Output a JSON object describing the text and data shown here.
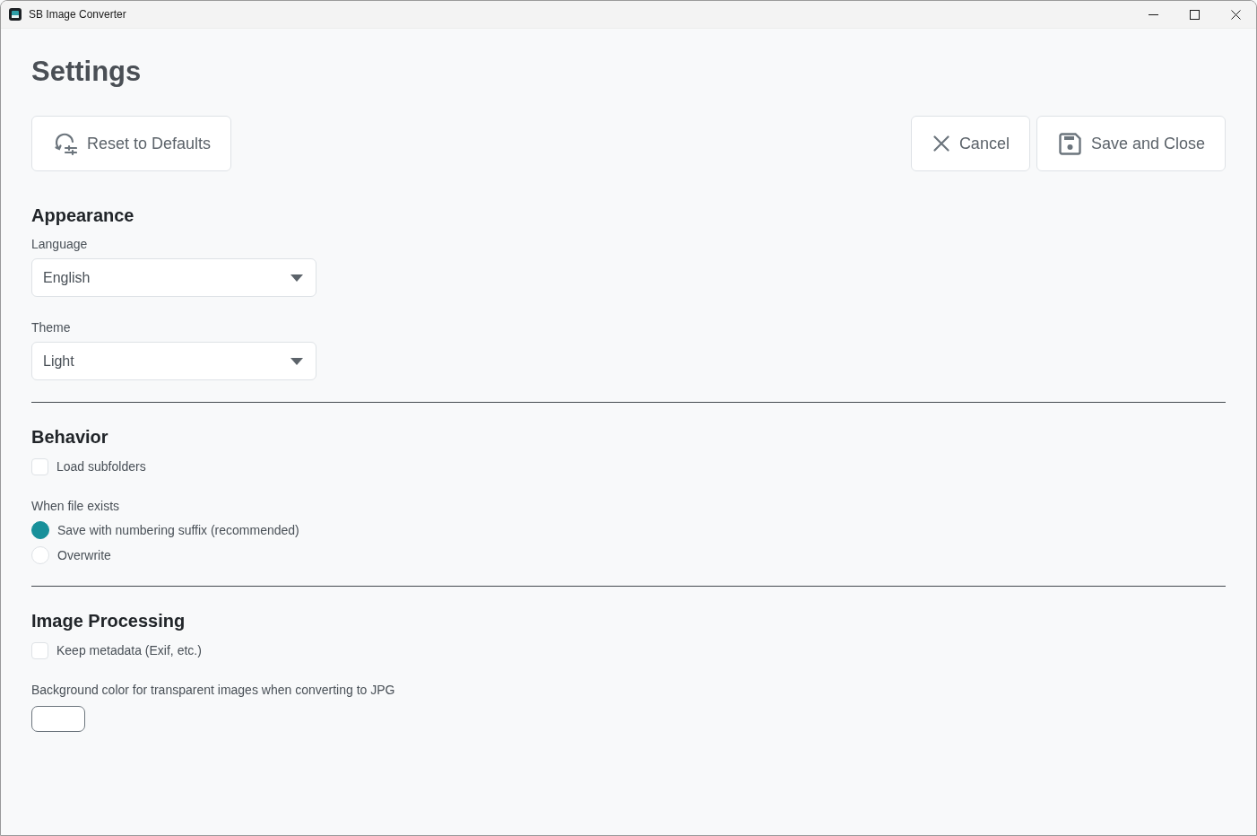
{
  "window": {
    "title": "SB Image Converter"
  },
  "page": {
    "title": "Settings"
  },
  "toolbar": {
    "left": [
      {
        "kind": "reset",
        "label": "Reset to Defaults"
      }
    ],
    "right": [
      {
        "kind": "cancel",
        "label": "Cancel"
      },
      {
        "kind": "save",
        "label": "Save and Close"
      }
    ]
  },
  "sections": [
    {
      "title": "Appearance",
      "items": [
        {
          "kind": "select",
          "label": "Language",
          "value": "English"
        },
        {
          "kind": "select",
          "label": "Theme",
          "value": "Light"
        }
      ]
    },
    {
      "title": "Behavior",
      "items": [
        {
          "kind": "checkbox",
          "label": "Load subfolders",
          "checked": false
        },
        {
          "kind": "radio_group",
          "label": "When file exists",
          "options": [
            {
              "label": "Save with numbering suffix (recommended)",
              "selected": true
            },
            {
              "label": "Overwrite",
              "selected": false
            }
          ]
        }
      ]
    },
    {
      "title": "Image Processing",
      "items": [
        {
          "kind": "checkbox",
          "label": "Keep metadata (Exif, etc.)",
          "checked": false
        },
        {
          "kind": "color",
          "label": "Background color for transparent images when converting to JPG",
          "color": "#ffffff"
        }
      ]
    }
  ]
}
